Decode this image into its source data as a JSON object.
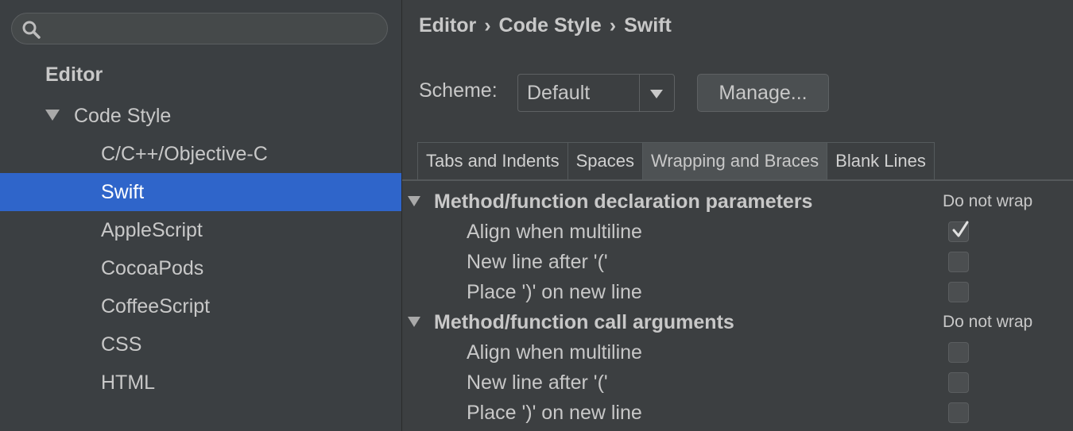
{
  "sidebar": {
    "search": {
      "value": "",
      "placeholder": ""
    },
    "items": [
      {
        "label": "Editor"
      },
      {
        "label": "Code Style"
      },
      {
        "label": "C/C++/Objective-C"
      },
      {
        "label": "Swift"
      },
      {
        "label": "AppleScript"
      },
      {
        "label": "CocoaPods"
      },
      {
        "label": "CoffeeScript"
      },
      {
        "label": "CSS"
      },
      {
        "label": "HTML"
      }
    ]
  },
  "header": {
    "breadcrumb": [
      "Editor",
      "Code Style",
      "Swift"
    ],
    "separator": "›"
  },
  "scheme": {
    "label": "Scheme:",
    "value": "Default",
    "manage_label": "Manage..."
  },
  "tabs": [
    {
      "label": "Tabs and Indents"
    },
    {
      "label": "Spaces"
    },
    {
      "label": "Wrapping and Braces",
      "active": true
    },
    {
      "label": "Blank Lines"
    }
  ],
  "groups": [
    {
      "title": "Method/function declaration parameters",
      "wrap": "Do not wrap",
      "options": [
        {
          "label": "Align when multiline",
          "checked": true
        },
        {
          "label": "New line after '('",
          "checked": false
        },
        {
          "label": "Place ')' on new line",
          "checked": false
        }
      ]
    },
    {
      "title": "Method/function call arguments",
      "wrap": "Do not wrap",
      "options": [
        {
          "label": "Align when multiline",
          "checked": false
        },
        {
          "label": "New line after '('",
          "checked": false
        },
        {
          "label": "Place ')' on new line",
          "checked": false
        }
      ]
    }
  ],
  "colors": {
    "selection": "#2f65ca",
    "background": "#3c3f41"
  }
}
